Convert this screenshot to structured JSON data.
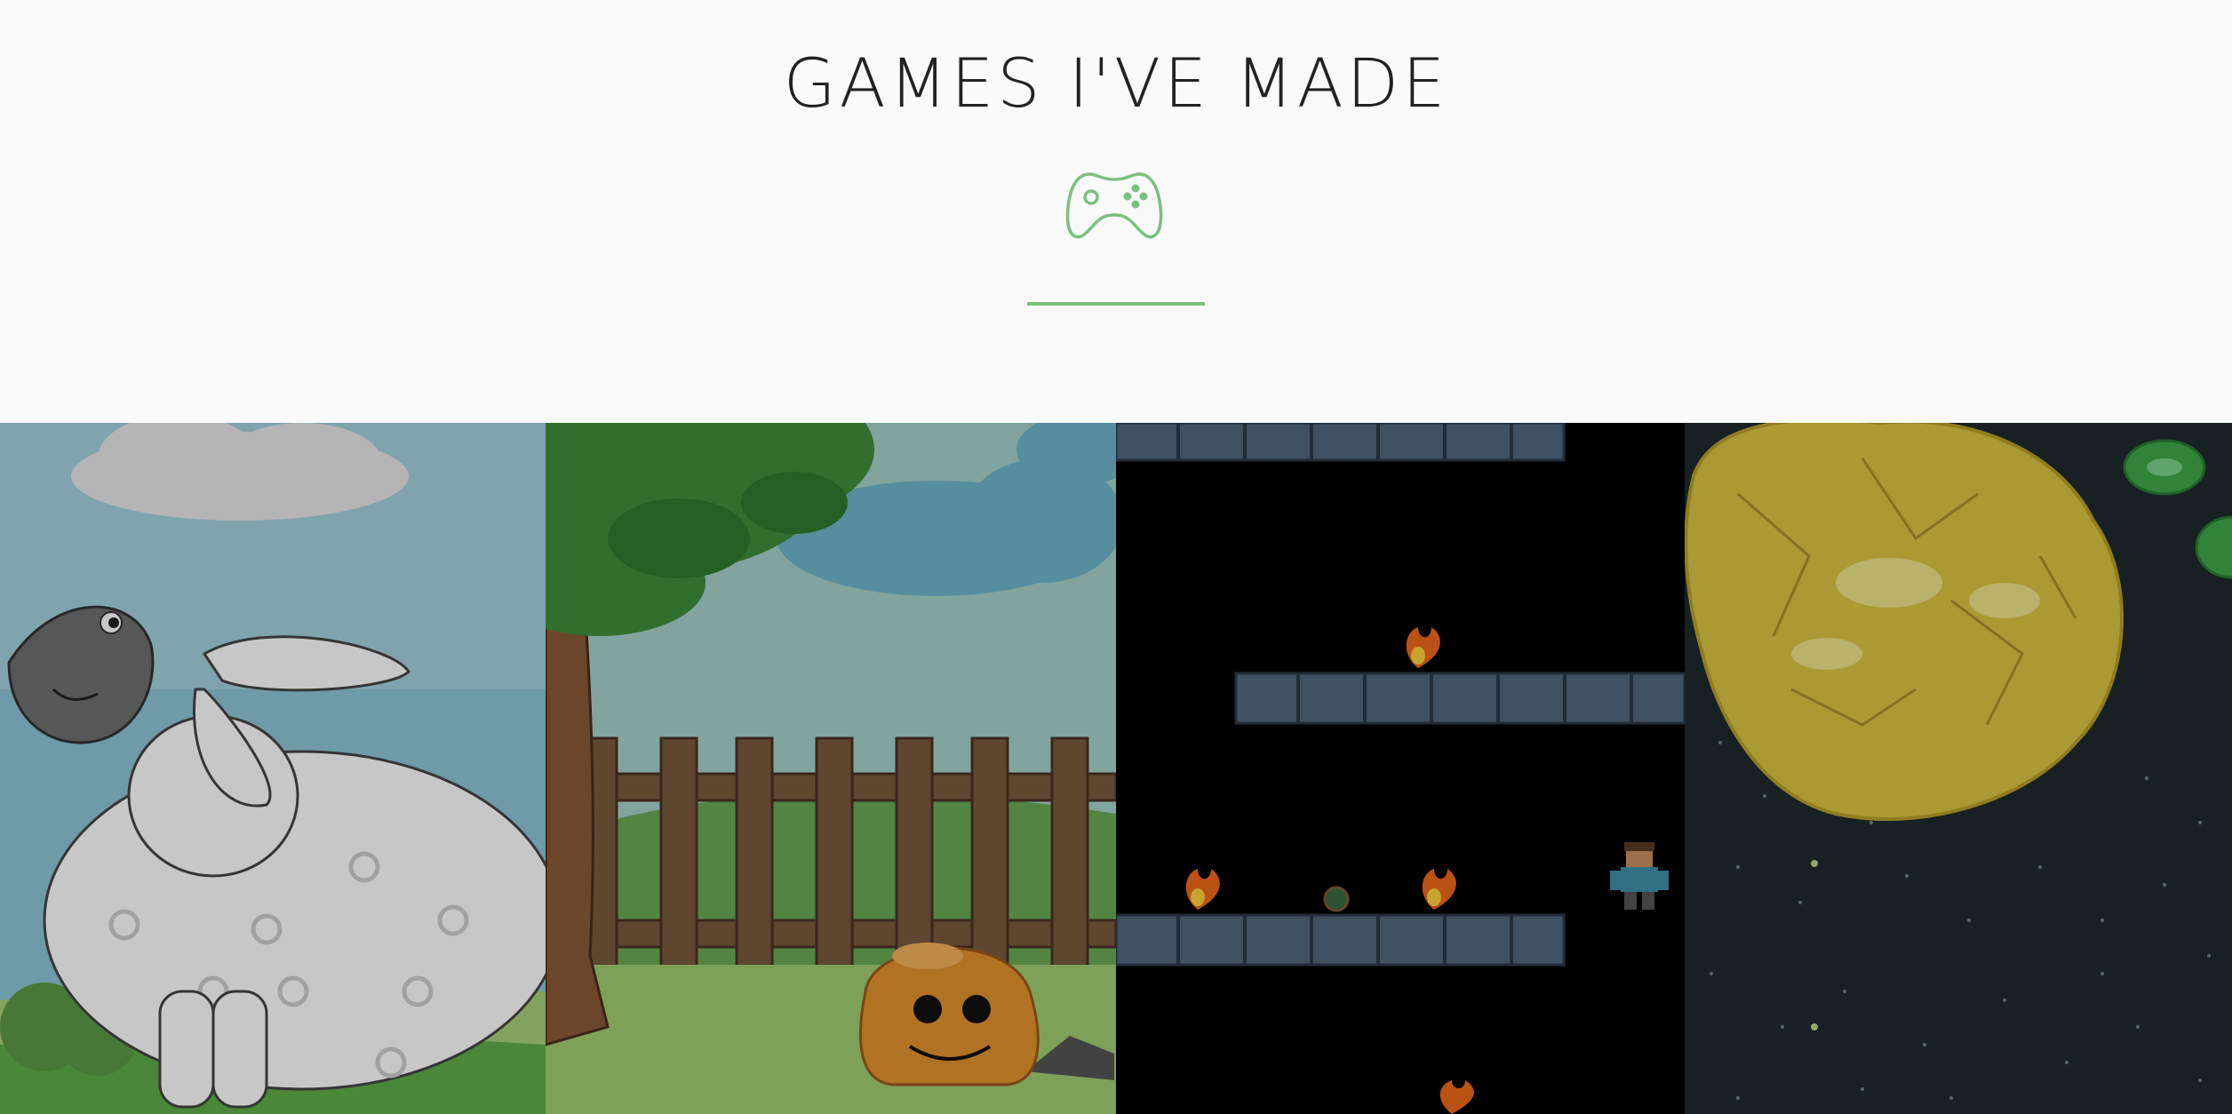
{
  "section": {
    "title": "GAMES I'VE MADE",
    "icon": "gamepad-icon",
    "accent_color": "#7ac07f"
  },
  "games": [
    {
      "thumbnail": "sheep-game-thumbnail",
      "icon": "sheep-icon"
    },
    {
      "thumbnail": "slime-game-thumbnail",
      "icon": "slime-icon"
    },
    {
      "thumbnail": "platformer-game-thumbnail",
      "icon": "platformer-icon"
    },
    {
      "thumbnail": "space-game-thumbnail",
      "icon": "asteroid-icon"
    }
  ]
}
